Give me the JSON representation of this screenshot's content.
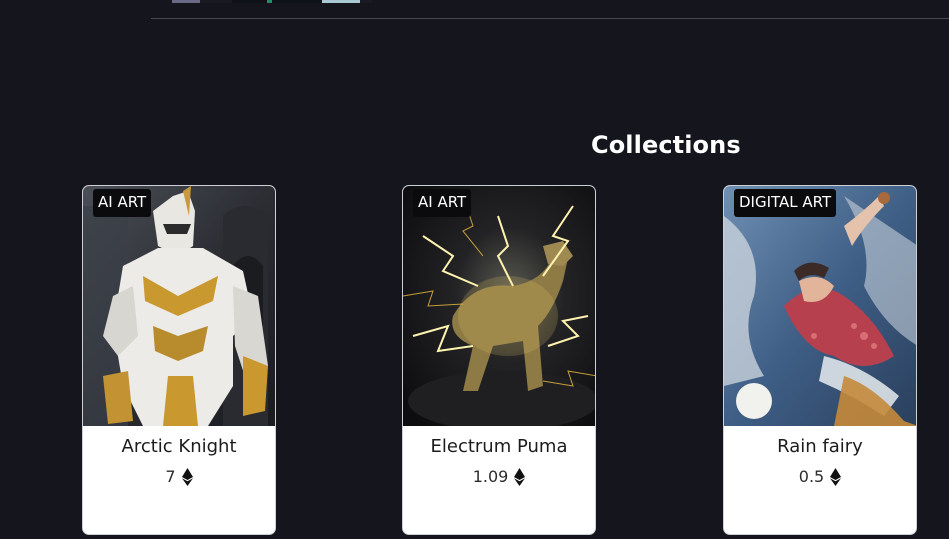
{
  "section": {
    "title": "Collections"
  },
  "cards": [
    {
      "badge": "AI ART",
      "title": "Arctic Knight",
      "price": "7",
      "currency_icon": "ethereum-icon"
    },
    {
      "badge": "AI ART",
      "title": "Electrum Puma",
      "price": "1.09",
      "currency_icon": "ethereum-icon"
    },
    {
      "badge": "DIGITAL ART",
      "title": "Rain fairy",
      "price": "0.5",
      "currency_icon": "ethereum-icon"
    }
  ],
  "colors": {
    "background": "#15151e",
    "card": "#ffffff",
    "badge": "#0b0b0e",
    "heading": "#ffffff"
  }
}
